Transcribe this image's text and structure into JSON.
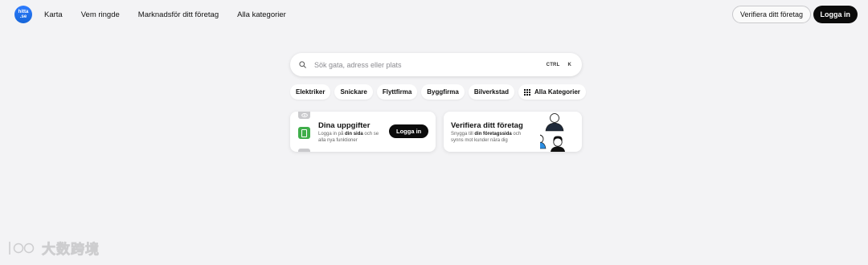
{
  "brand": {
    "logo_line1": "hitta",
    "logo_line2": ".se"
  },
  "nav": {
    "items": [
      "Karta",
      "Vem ringde",
      "Marknadsför ditt företag",
      "Alla kategorier"
    ]
  },
  "header": {
    "verify_label": "Verifiera ditt företag",
    "login_label": "Logga in"
  },
  "search": {
    "placeholder": "Sök gata, adress eller plats",
    "value": "",
    "shortcut_ctrl": "CTRL",
    "shortcut_key": "K"
  },
  "chips": {
    "items": [
      "Elektriker",
      "Snickare",
      "Flyttfirma",
      "Byggfirma",
      "Bilverkstad"
    ],
    "all_categories": "Alla Kategorier"
  },
  "card_details": {
    "title": "Dina uppgifter",
    "sub_pre": "Logga in på ",
    "sub_bold": "din sida",
    "sub_post": " och se alla nya funktioner",
    "button_label": "Logga in"
  },
  "card_verify": {
    "title": "Verifiera ditt företag",
    "sub_pre": "Snygga till ",
    "sub_bold": "din företagssida",
    "sub_post": " och synns mot kunder nära dig"
  },
  "watermark": {
    "text": "大数跨境"
  },
  "icons": {
    "logo": "hitta-logo",
    "search": "search-icon",
    "grid": "grid-icon",
    "eye": "eye-icon",
    "document": "document-icon"
  },
  "colors": {
    "background": "#f3f3f5",
    "primary_button": "#0b0b0b",
    "logo_blue": "#1f6fe8",
    "doc_green": "#3fae4a"
  }
}
